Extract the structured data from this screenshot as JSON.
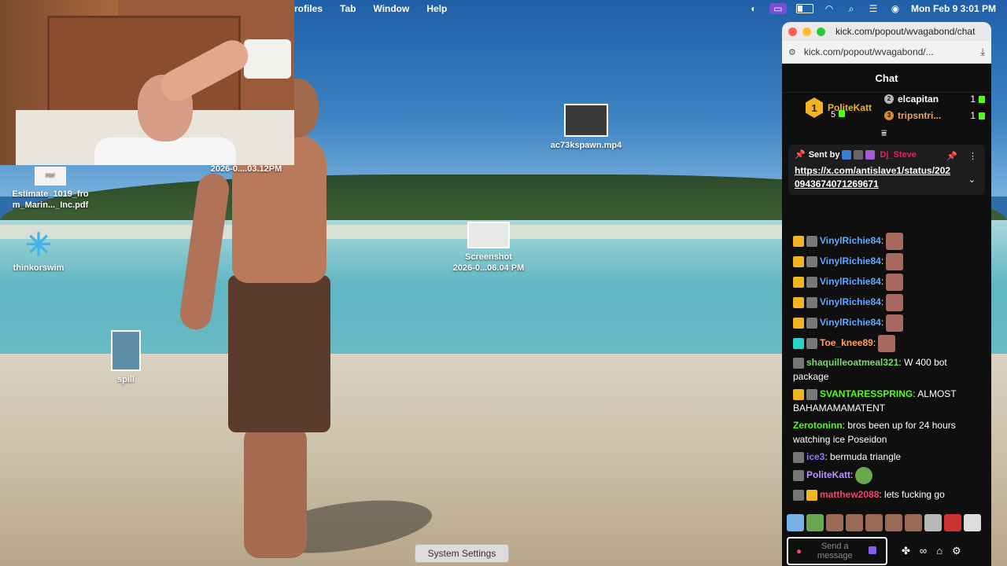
{
  "menubar": {
    "items": [
      "rofiles",
      "Tab",
      "Window",
      "Help"
    ],
    "clock": "Mon Feb 9  3:01 PM"
  },
  "webcam": {
    "caption": "2026-0....03.12PM"
  },
  "desktop": {
    "icons": [
      {
        "name": "Estimate_1019_fro\nm_Marin..._Inc.pdf",
        "thumb": "PDF"
      },
      {
        "name": "thinkorswim"
      },
      {
        "name": "spill"
      },
      {
        "name": "ac73kspawn.mp4"
      },
      {
        "name": "Screenshot\n2026-0...06.04 PM"
      }
    ],
    "tooltip": "System Settings"
  },
  "browser": {
    "title": "kick.com/popout/wvagabond/chat",
    "url": "kick.com/popout/wvagabond/..."
  },
  "chat": {
    "header": "Chat",
    "leaderboard": {
      "top": {
        "rank": "1",
        "name": "PoliteKatt",
        "count": "5"
      },
      "rows": [
        {
          "rank": "2",
          "name": "elcapitan",
          "count": "1"
        },
        {
          "rank": "3",
          "name": "tripsntri...",
          "count": "1"
        }
      ]
    },
    "pinned": {
      "label": "Sent by",
      "sender": "Dj_Steve",
      "link": "https://x.com/antislave1/status/2020943674071269671"
    },
    "messages": [
      {
        "user": "VinylRichie84",
        "text": ""
      },
      {
        "user": "VinylRichie84",
        "text": ""
      },
      {
        "user": "VinylRichie84",
        "text": ""
      },
      {
        "user": "VinylRichie84",
        "text": ""
      },
      {
        "user": "VinylRichie84",
        "text": ""
      },
      {
        "user": "Toe_knee89",
        "text": ""
      },
      {
        "user": "shaquilleoatmeal321",
        "text": "W 400 bot package"
      },
      {
        "user": "SVANTARESSPRING",
        "text": "ALMOST BAHAMAMAMATENT"
      },
      {
        "user": "Zerotoninn",
        "text": "bros been up for 24 hours watching ice Poseidon"
      },
      {
        "user": "ice3",
        "text": "bermuda triangle"
      },
      {
        "user": "PoliteKatt",
        "text": ""
      },
      {
        "user": "matthew2088",
        "text": "lets fucking go"
      }
    ],
    "input_placeholder": "Send a message"
  },
  "colors": {
    "kick_green": "#53fc18",
    "chat_bg": "#0f0f10",
    "accent_purple": "#8b5cf6"
  }
}
